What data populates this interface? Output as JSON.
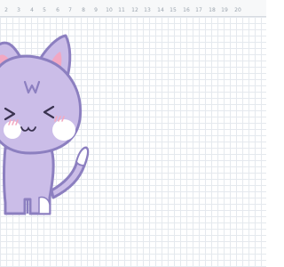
{
  "column_header": {
    "labels": [
      "2",
      "3",
      "4",
      "5",
      "6",
      "7",
      "8",
      "9",
      "10",
      "11",
      "12",
      "13",
      "14",
      "15",
      "16",
      "17",
      "18",
      "19",
      "20"
    ]
  },
  "canvas": {
    "grid_visible": true,
    "illustration": "cat-icon"
  },
  "colors": {
    "outline": "#8c7fc0",
    "fill": "#cbbde8",
    "ear_inner": "#f2a7c2",
    "cheek": "#f4a9c0",
    "white": "#ffffff",
    "grid_line": "#e5e9ee"
  }
}
